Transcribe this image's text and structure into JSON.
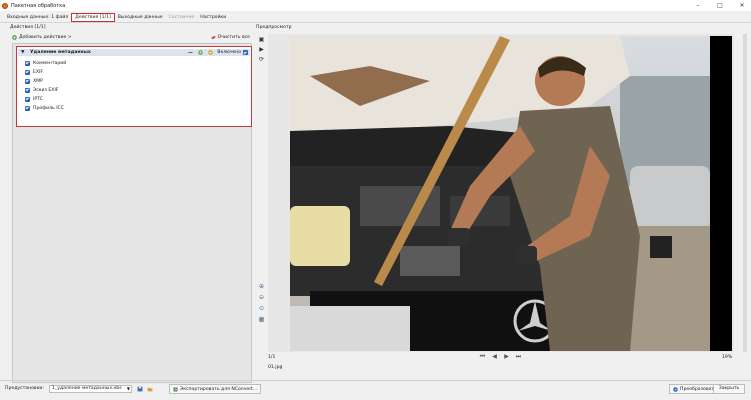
{
  "window": {
    "title": "Пакетная обработка",
    "controls": [
      "–",
      "□",
      "✕"
    ]
  },
  "tabs": [
    {
      "label": "Входные данные: 1 файл",
      "state": "normal"
    },
    {
      "label": "Действия [1/1]",
      "state": "active"
    },
    {
      "label": "Выходные данные",
      "state": "normal"
    },
    {
      "label": "Состояние",
      "state": "disabled"
    },
    {
      "label": "Настройки",
      "state": "normal"
    }
  ],
  "actions_panel": {
    "label": "Действия [1/1]",
    "add_action_label": "Добавить действие >",
    "clear_all_label": "Очистить все",
    "group": {
      "title": "Удаление метаданных",
      "enabled_label": "Включено",
      "enabled": true,
      "options": [
        {
          "label": "Комментарий",
          "checked": true
        },
        {
          "label": "EXIF",
          "checked": true
        },
        {
          "label": "XMP",
          "checked": true
        },
        {
          "label": "Эскиз EXIF",
          "checked": true
        },
        {
          "label": "IPTC",
          "checked": true
        },
        {
          "label": "Профиль ICC",
          "checked": true
        }
      ]
    }
  },
  "preview": {
    "label": "Предпросмотр",
    "counter": "1/1",
    "filename": "01.jpg",
    "zoom": "19%",
    "nav_buttons": [
      "⏮",
      "◀",
      "▶",
      "⏭"
    ]
  },
  "bottom_bar": {
    "preset_label": "Предустановки:",
    "preset_value": "1_удаление метаданных.xbs",
    "export_label": "Экспортировать для NConvert...",
    "convert_label": "Преобразовать",
    "close_label": "Закрыть"
  },
  "colors": {
    "accent": "#2b62b5",
    "highlight_border": "#c43a3a",
    "header_bg": "#dbe3ee"
  }
}
